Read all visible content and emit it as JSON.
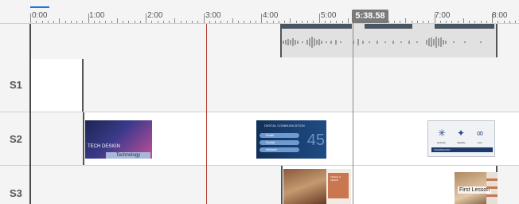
{
  "ruler": {
    "time_labels": [
      "0:00",
      "1:00",
      "2:00",
      "3:00",
      "4:00",
      "5:00",
      "7:00",
      "8:00"
    ]
  },
  "playhead": {
    "time": "5:38.58"
  },
  "tracks": [
    {
      "label": "S1"
    },
    {
      "label": "S2"
    },
    {
      "label": "S3"
    }
  ],
  "clips": {
    "tech_design": {
      "caption": "TECH DESIGN",
      "subtitle": "Technology"
    },
    "digital_comm": {
      "heading": "DIGITAL COMMUNICATION",
      "rows": [
        "Email",
        "Social",
        "Internet"
      ],
      "side_text": "45"
    },
    "tech_diagram": {
      "items": [
        "Network",
        "Satellite",
        "Link"
      ],
      "footer": "TECHNOLOGY"
    },
    "course": {
      "panel_text": "TEACH & LEARN"
    },
    "first_lesson": {
      "title": "First Lesson"
    }
  },
  "colors": {
    "playhead_badge": "#7a7a7a",
    "time_marker": "#b33b32",
    "active_tab": "#1a73e8",
    "lane_background": "#f4f4f4"
  }
}
